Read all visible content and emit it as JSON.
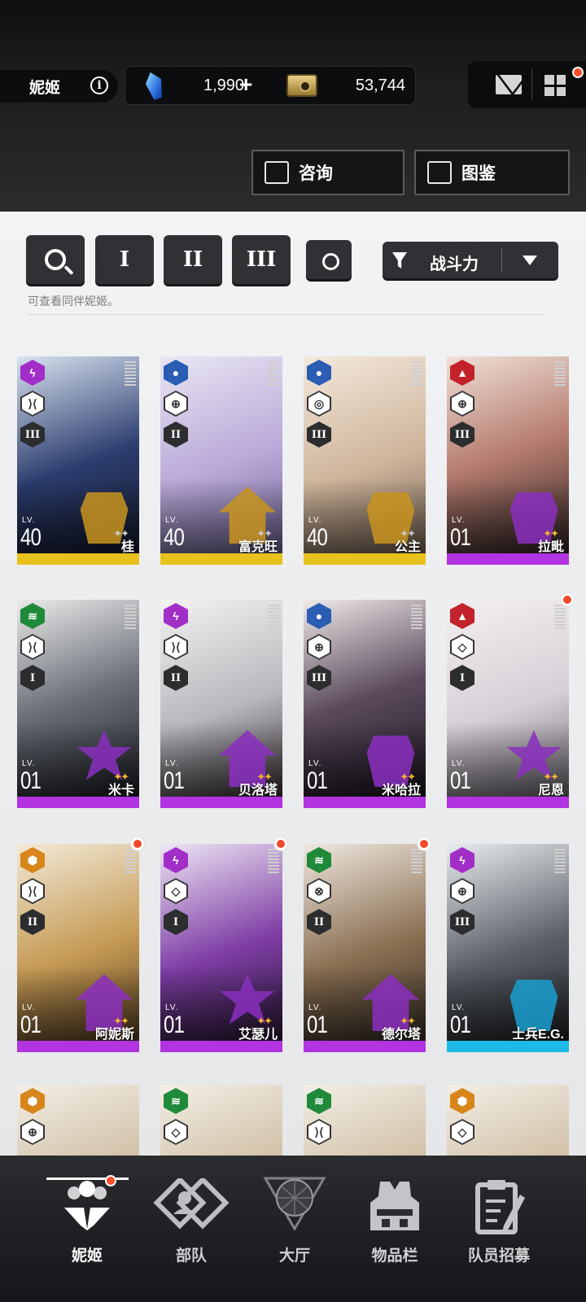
{
  "header": {
    "title": "妮姬",
    "gem_value": "1,990",
    "plus_label": "+",
    "credit_value": "53,744",
    "consult_label": "咨询",
    "book_label": "图鉴"
  },
  "filters": {
    "burst_1": "I",
    "burst_2": "II",
    "burst_3": "III",
    "sort_label": "战斗力",
    "hint": "可查看同伴妮姬。"
  },
  "colors": {
    "electric": "#a22ec8",
    "water": "#2a5db3",
    "fire": "#c2232a",
    "wind": "#1f8a3a",
    "iron": "#d8861c",
    "gold_bar": "#e7c21c",
    "purple_bar": "#b233e0",
    "blue_bar": "#1ebae6"
  },
  "cards": [
    {
      "lv": "40",
      "name": "桂",
      "element": "electric-icon",
      "weapon": "crosshair-split-icon",
      "burst": "III",
      "rarity": "gold",
      "stars": "✦✦"
    },
    {
      "lv": "40",
      "name": "富克旺",
      "element": "water-icon",
      "weapon": "crosshair-icon",
      "burst": "II",
      "rarity": "gold",
      "stars": "✦✦"
    },
    {
      "lv": "40",
      "name": "公主",
      "element": "water-icon",
      "weapon": "ring-icon",
      "burst": "III",
      "rarity": "gold",
      "stars": "✦✦"
    },
    {
      "lv": "01",
      "name": "拉毗",
      "element": "fire-icon",
      "weapon": "crosshair-icon",
      "burst": "III",
      "rarity": "purple",
      "stars": "✦✦"
    },
    {
      "lv": "01",
      "name": "米卡",
      "element": "wind-icon",
      "weapon": "crosshair-split-icon",
      "burst": "I",
      "rarity": "purple",
      "stars": "✦✦"
    },
    {
      "lv": "01",
      "name": "贝洛塔",
      "element": "electric-icon",
      "weapon": "crosshair-split-icon",
      "burst": "II",
      "rarity": "purple",
      "stars": "✦✦"
    },
    {
      "lv": "01",
      "name": "米哈拉",
      "element": "water-icon",
      "weapon": "crosshair-icon",
      "burst": "III",
      "rarity": "purple",
      "stars": "✦✦"
    },
    {
      "lv": "01",
      "name": "尼恩",
      "element": "fire-icon",
      "weapon": "diamond-target-icon",
      "burst": "I",
      "rarity": "purple",
      "stars": "✦✦"
    },
    {
      "lv": "01",
      "name": "阿妮斯",
      "element": "iron-icon",
      "weapon": "crosshair-split-icon",
      "burst": "II",
      "rarity": "purple",
      "stars": "✦✦"
    },
    {
      "lv": "01",
      "name": "艾瑟儿",
      "element": "electric-icon",
      "weapon": "diamond-target-icon",
      "burst": "I",
      "rarity": "purple",
      "stars": "✦✦"
    },
    {
      "lv": "01",
      "name": "德尔塔",
      "element": "wind-icon",
      "weapon": "scope-icon",
      "burst": "II",
      "rarity": "purple",
      "stars": "✦✦"
    },
    {
      "lv": "01",
      "name": "士兵E.G.",
      "element": "electric-icon",
      "weapon": "crosshair-icon",
      "burst": "III",
      "rarity": "blue",
      "stars": ""
    }
  ],
  "partial_cards": [
    {
      "element": "iron-icon",
      "weapon": "crosshair-icon"
    },
    {
      "element": "wind-icon",
      "weapon": "diamond-target-icon"
    },
    {
      "element": "wind-icon",
      "weapon": "crosshair-split-icon"
    },
    {
      "element": "iron-icon",
      "weapon": "diamond-target-icon"
    }
  ],
  "nav": {
    "nikke": "妮姬",
    "squad": "部队",
    "lobby": "大厅",
    "inventory": "物品栏",
    "recruit": "队员招募"
  }
}
